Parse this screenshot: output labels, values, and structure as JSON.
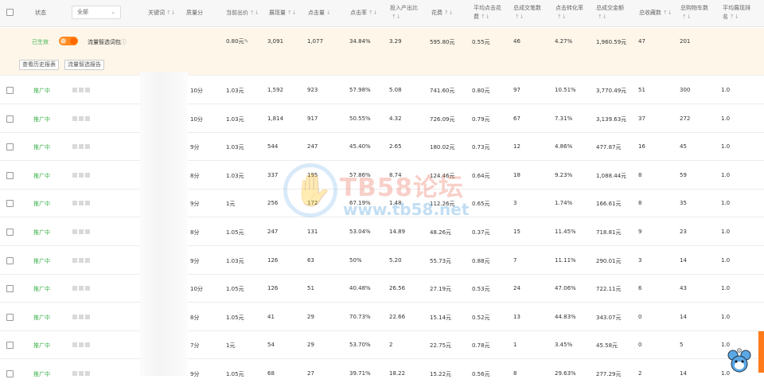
{
  "header": {
    "status": "状态",
    "filter_value": "全部",
    "keyword": "关键词",
    "quality": "质量分",
    "bid": "当前出价",
    "impressions": "展现量",
    "clicks": "点击量",
    "ctr": "点击率",
    "roi_l1": "投入产出比",
    "cost": "花费",
    "avg_cpc_l1": "平均点击花",
    "avg_cpc_l2": "费",
    "orders": "总成交笔数",
    "cvr": "点击转化率",
    "amount": "总成交金额",
    "fav": "总收藏数",
    "cart": "总购物车数",
    "avg_rank_l1": "平均展现排",
    "avg_rank_l2": "名",
    "sort_both": "↑↓",
    "sort_down": "↓"
  },
  "summary": {
    "status": "已生效",
    "package": "流量智选词包",
    "info_icon": "ⓘ",
    "bid": "0.80元",
    "impressions": "3,091",
    "clicks": "1,077",
    "ctr": "34.84%",
    "roi": "3.29",
    "cost": "595.80元",
    "avg_cpc": "0.55元",
    "orders": "46",
    "cvr": "4.27%",
    "amount": "1,960.59元",
    "fav": "47",
    "cart": "201",
    "btn_history": "查看历史报表",
    "btn_report": "流量智选报告"
  },
  "rows": [
    {
      "status": "推广中",
      "quality": "10分",
      "bid": "1.03元",
      "imp": "1,592",
      "clk": "923",
      "ctr": "57.98%",
      "roi": "5.08",
      "cost": "741.60元",
      "cpc": "0.80元",
      "orders": "97",
      "cvr": "10.51%",
      "amount": "3,770.49元",
      "fav": "51",
      "cart": "300",
      "rank": "1.0"
    },
    {
      "status": "推广中",
      "quality": "10分",
      "bid": "1.03元",
      "imp": "1,814",
      "clk": "917",
      "ctr": "50.55%",
      "roi": "4.32",
      "cost": "726.09元",
      "cpc": "0.79元",
      "orders": "67",
      "cvr": "7.31%",
      "amount": "3,139.63元",
      "fav": "37",
      "cart": "272",
      "rank": "1.0"
    },
    {
      "status": "推广中",
      "quality": "9分",
      "bid": "1.03元",
      "imp": "544",
      "clk": "247",
      "ctr": "45.40%",
      "roi": "2.65",
      "cost": "180.02元",
      "cpc": "0.73元",
      "orders": "12",
      "cvr": "4.86%",
      "amount": "477.87元",
      "fav": "16",
      "cart": "45",
      "rank": "1.0"
    },
    {
      "status": "推广中",
      "quality": "8分",
      "bid": "1.03元",
      "imp": "337",
      "clk": "195",
      "ctr": "57.86%",
      "roi": "8.74",
      "cost": "124.46元",
      "cpc": "0.64元",
      "orders": "18",
      "cvr": "9.23%",
      "amount": "1,088.44元",
      "fav": "8",
      "cart": "59",
      "rank": "1.0"
    },
    {
      "status": "推广中",
      "quality": "9分",
      "bid": "1元",
      "imp": "256",
      "clk": "172",
      "ctr": "67.19%",
      "roi": "1.48",
      "cost": "112.26元",
      "cpc": "0.65元",
      "orders": "3",
      "cvr": "1.74%",
      "amount": "166.61元",
      "fav": "8",
      "cart": "35",
      "rank": "1.0"
    },
    {
      "status": "推广中",
      "quality": "8分",
      "bid": "1.05元",
      "imp": "247",
      "clk": "131",
      "ctr": "53.04%",
      "roi": "14.89",
      "cost": "48.26元",
      "cpc": "0.37元",
      "orders": "15",
      "cvr": "11.45%",
      "amount": "718.81元",
      "fav": "9",
      "cart": "23",
      "rank": "1.0"
    },
    {
      "status": "推广中",
      "quality": "9分",
      "bid": "1.03元",
      "imp": "126",
      "clk": "63",
      "ctr": "50%",
      "roi": "5.20",
      "cost": "55.73元",
      "cpc": "0.88元",
      "orders": "7",
      "cvr": "11.11%",
      "amount": "290.01元",
      "fav": "3",
      "cart": "14",
      "rank": "1.0"
    },
    {
      "status": "推广中",
      "quality": "10分",
      "bid": "1.05元",
      "imp": "126",
      "clk": "51",
      "ctr": "40.48%",
      "roi": "26.56",
      "cost": "27.19元",
      "cpc": "0.53元",
      "orders": "24",
      "cvr": "47.06%",
      "amount": "722.11元",
      "fav": "6",
      "cart": "43",
      "rank": "1.0"
    },
    {
      "status": "推广中",
      "quality": "8分",
      "bid": "1.05元",
      "imp": "41",
      "clk": "29",
      "ctr": "70.73%",
      "roi": "22.66",
      "cost": "15.14元",
      "cpc": "0.52元",
      "orders": "13",
      "cvr": "44.83%",
      "amount": "343.07元",
      "fav": "0",
      "cart": "14",
      "rank": "1.0"
    },
    {
      "status": "推广中",
      "quality": "7分",
      "bid": "1元",
      "imp": "54",
      "clk": "29",
      "ctr": "53.70%",
      "roi": "2",
      "cost": "22.75元",
      "cpc": "0.78元",
      "orders": "1",
      "cvr": "3.45%",
      "amount": "45.58元",
      "fav": "0",
      "cart": "5",
      "rank": "1.0"
    },
    {
      "status": "推广中",
      "quality": "9分",
      "bid": "1.05元",
      "imp": "68",
      "clk": "27",
      "ctr": "39.71%",
      "roi": "18.22",
      "cost": "15.22元",
      "cpc": "0.56元",
      "orders": "8",
      "cvr": "29.63%",
      "amount": "277.29元",
      "fav": "2",
      "cart": "14",
      "rank": "1.0"
    }
  ],
  "watermark": {
    "text": "TB58论坛",
    "url": "www.tb58.net"
  },
  "colors": {
    "accent": "#ff6a00",
    "active_green": "#3db24b",
    "summary_bg": "#fdf6e9",
    "header_bg": "#f7f7f7"
  }
}
